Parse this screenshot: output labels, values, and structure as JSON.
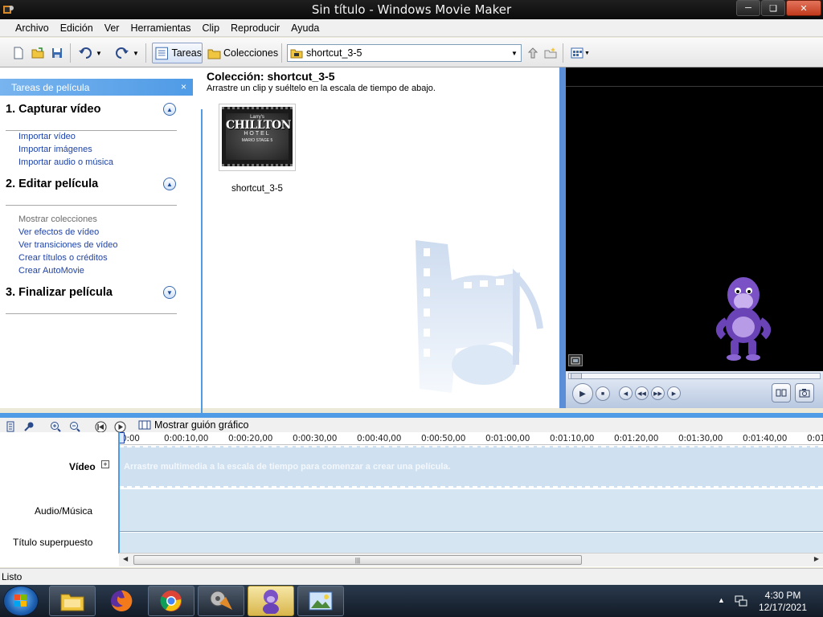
{
  "window": {
    "title": "Sin título - Windows Movie Maker"
  },
  "menu": [
    "Archivo",
    "Edición",
    "Ver",
    "Herramientas",
    "Clip",
    "Reproducir",
    "Ayuda"
  ],
  "toolbar": {
    "tareas_label": "Tareas",
    "colecciones_label": "Colecciones",
    "collection_combo_value": "shortcut_3-5"
  },
  "tasks": {
    "header": "Tareas de película",
    "sections": [
      {
        "title": "1. Capturar vídeo",
        "links": [
          "Importar vídeo",
          "Importar imágenes",
          "Importar audio o música"
        ]
      },
      {
        "title": "2. Editar película",
        "links": [
          "Mostrar colecciones",
          "Ver efectos de vídeo",
          "Ver transiciones de vídeo",
          "Crear títulos o créditos",
          "Crear AutoMovie"
        ]
      },
      {
        "title": "3. Finalizar película",
        "links": []
      }
    ]
  },
  "collection": {
    "title": "Colección: shortcut_3-5",
    "subtitle": "Arrastre un clip y suéltelo en la escala de tiempo de abajo.",
    "clip": {
      "name": "shortcut_3-5",
      "thumb_line1": "Larry's",
      "thumb_line2": "CHILLTON",
      "thumb_line3": "HOTEL",
      "thumb_line4": "MARIO STAGE 5"
    }
  },
  "timeline": {
    "storyboard_label": "Mostrar guión gráfico",
    "ticks": [
      "0:00",
      "0:00:10,00",
      "0:00:20,00",
      "0:00:30,00",
      "0:00:40,00",
      "0:00:50,00",
      "0:01:00,00",
      "0:01:10,00",
      "0:01:20,00",
      "0:01:30,00",
      "0:01:40,00",
      "0:01"
    ],
    "tracks": {
      "video": "Vídeo",
      "audio": "Audio/Música",
      "title": "Título superpuesto"
    },
    "video_hint": "Arrastre multimedia a la escala de tiempo para comenzar a crear una película."
  },
  "status": {
    "text": "Listo"
  },
  "taskbar": {
    "time": "4:30 PM",
    "date": "12/17/2021"
  },
  "colors": {
    "accent": "#4f9be6",
    "link": "#1f43a8",
    "track": "#d6e5f2"
  },
  "icons": [
    "app-icon",
    "new-project-icon",
    "open-project-icon",
    "save-icon",
    "undo-icon",
    "redo-icon",
    "tasks-icon",
    "folder-icon",
    "collection-icon",
    "up-folder-icon",
    "new-folder-icon",
    "views-icon",
    "play-icon",
    "stop-icon",
    "fullscreen-icon",
    "zoom-in-icon",
    "zoom-out-icon",
    "rewind-icon",
    "storyboard-icon",
    "start-icon",
    "explorer-icon",
    "firefox-icon",
    "chrome-icon",
    "movie-maker-icon",
    "bonzi-icon",
    "photo-viewer-icon",
    "network-icon"
  ]
}
